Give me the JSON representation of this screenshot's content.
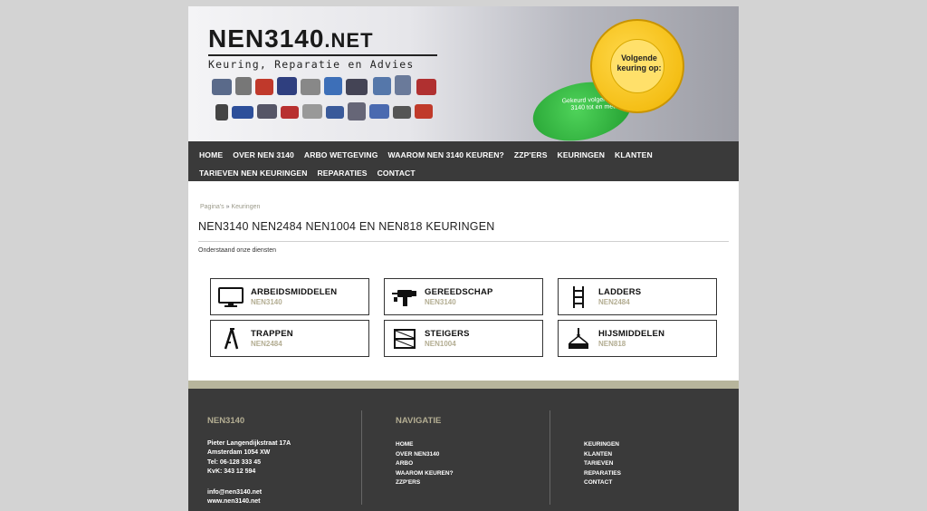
{
  "logo": {
    "main": "NEN3140",
    "suffix": ".NET",
    "subtitle": "Keuring, Reparatie en Advies"
  },
  "sticker": {
    "yellow_text": "Volgende keuring op:",
    "green_text": "Gekeurd volgens NEN 3140 tot en met:"
  },
  "nav": {
    "row1": [
      "HOME",
      "OVER NEN 3140",
      "ARBO WETGEVING",
      "WAAROM NEN 3140 KEUREN?",
      "ZZP'ERS",
      "KEURINGEN",
      "KLANTEN"
    ],
    "row2": [
      "TARIEVEN NEN KEURINGEN",
      "REPARATIES",
      "CONTACT"
    ]
  },
  "breadcrumb": {
    "parent": "Pagina's",
    "separator": "»",
    "current": "Keuringen"
  },
  "page_title": "NEN3140 NEN2484 NEN1004 EN NEN818 KEURINGEN",
  "intro": "Onderstaand onze diensten",
  "services": [
    {
      "title": "ARBEIDSMIDDELEN",
      "sub": "NEN3140",
      "icon": "monitor-icon"
    },
    {
      "title": "GEREEDSCHAP",
      "sub": "NEN3140",
      "icon": "drill-icon"
    },
    {
      "title": "LADDERS",
      "sub": "NEN2484",
      "icon": "ladder-icon"
    },
    {
      "title": "TRAPPEN",
      "sub": "NEN2484",
      "icon": "stepladder-icon"
    },
    {
      "title": "STEIGERS",
      "sub": "NEN1004",
      "icon": "scaffold-icon"
    },
    {
      "title": "HIJSMIDDELEN",
      "sub": "NEN818",
      "icon": "hoist-icon"
    }
  ],
  "footer": {
    "col1": {
      "heading": "NEN3140",
      "address": [
        "Pieter Langendijkstraat 17A",
        "Amsterdam 1054 XW",
        "Tel: 06-128 333 45",
        "KvK: 343 12 594"
      ],
      "contact": [
        "info@nen3140.net",
        "www.nen3140.net"
      ]
    },
    "col2": {
      "heading": "NAVIGATIE",
      "links": [
        "HOME",
        "OVER NEN3140",
        "ARBO",
        "WAAROM KEUREN?",
        "ZZP'ERS"
      ]
    },
    "col3": {
      "links": [
        "KEURINGEN",
        "KLANTEN",
        "TARIEVEN",
        "REPARATIES",
        "CONTACT"
      ]
    }
  },
  "colors": {
    "background": "#d3d3d3",
    "nav": "#3a3a3a",
    "accent": "#b3ad92",
    "sticker_yellow": "#f0b400",
    "sticker_green": "#2fb63c"
  }
}
